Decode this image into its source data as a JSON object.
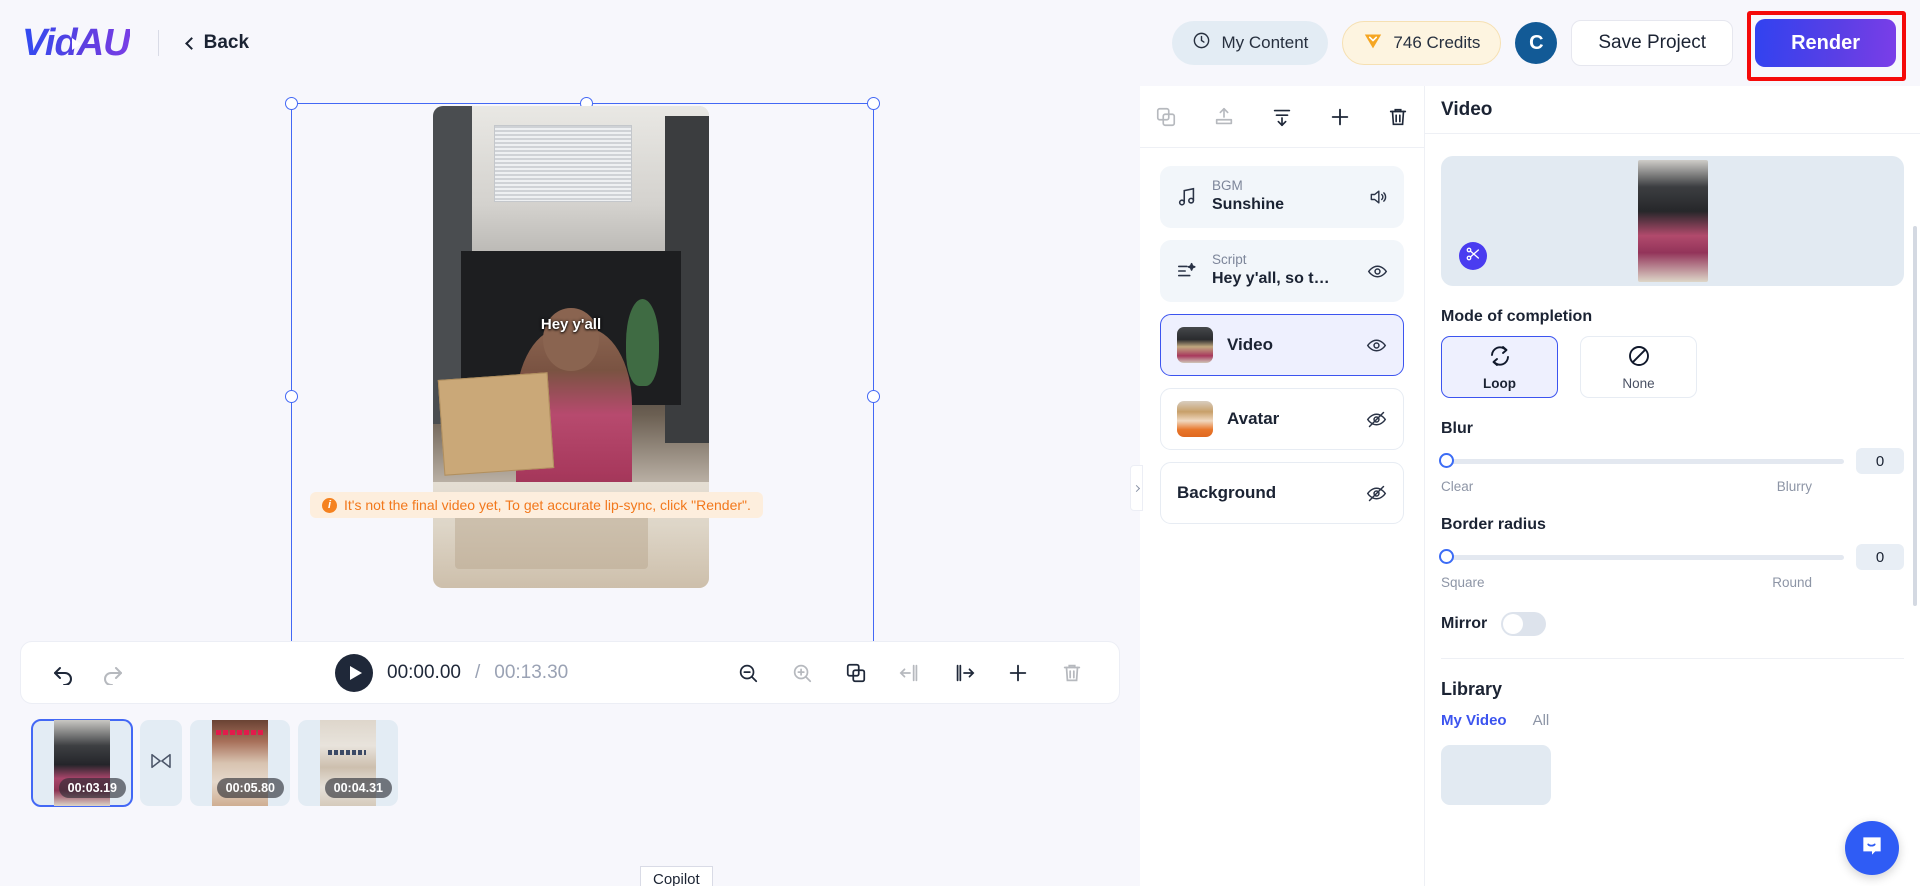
{
  "app": {
    "logo": "VidAU",
    "back_label": "Back"
  },
  "header": {
    "my_content_label": "My Content",
    "credits_label": "746 Credits",
    "avatar_initial": "C",
    "save_label": "Save Project",
    "render_label": "Render",
    "icons": {
      "clock": "clock-icon",
      "gem": "gem-icon"
    },
    "colors": {
      "render_gradient_start": "#3142f0",
      "render_gradient_end": "#7b3ee8",
      "annotation": "#f50a0a",
      "credits_bg": "#fdf4e0",
      "my_content_bg": "#e3ecf4",
      "avatar_bg": "#125a96"
    }
  },
  "canvas": {
    "caption_text": "Hey y'all",
    "warning_text": "It's not the final video yet, To get accurate lip-sync, click \"Render\".",
    "warning_color": "#f2781c"
  },
  "timeline": {
    "current_time": "00:00.00",
    "separator": "/",
    "total_time": "00:13.30",
    "clips": [
      {
        "name": "clip-1",
        "duration": "00:03.19",
        "selected": true
      },
      {
        "name": "clip-2",
        "duration": "00:05.80",
        "selected": false
      },
      {
        "name": "clip-3",
        "duration": "00:04.31",
        "selected": false
      }
    ],
    "icons": {
      "undo": "undo-icon",
      "redo": "redo-icon",
      "play": "play-icon",
      "zoom_out": "zoom-out-icon",
      "zoom_in": "zoom-in-icon",
      "duplicate": "duplicate-icon",
      "split_left": "split-left-icon",
      "split_right": "split-right-icon",
      "add": "plus-icon",
      "delete": "trash-icon",
      "transition": "transition-icon"
    }
  },
  "copilot": {
    "label": "Copilot"
  },
  "layers": {
    "toolbar_icons": [
      "duplicate-icon",
      "bring-forward-icon",
      "send-backward-icon",
      "plus-icon",
      "trash-icon"
    ],
    "items": [
      {
        "sub": "BGM",
        "title": "Sunshine",
        "icon": "music-note-icon",
        "action_icon": "speaker-icon",
        "state": "default"
      },
      {
        "sub": "Script",
        "title": "Hey y'all, so t…",
        "icon": "script-icon",
        "action_icon": "eye-icon",
        "state": "default"
      },
      {
        "sub": "",
        "title": "Video",
        "icon": "video-thumbnail",
        "action_icon": "eye-icon",
        "state": "selected"
      },
      {
        "sub": "",
        "title": "Avatar",
        "icon": "avatar-thumbnail",
        "action_icon": "eye-off-icon",
        "state": "plain"
      },
      {
        "sub": "",
        "title": "Background",
        "icon": "",
        "action_icon": "eye-off-icon",
        "state": "plain"
      }
    ]
  },
  "properties": {
    "title": "Video",
    "crop_icon": "scissors-icon",
    "mode": {
      "label": "Mode of completion",
      "options": [
        {
          "label": "Loop",
          "icon": "loop-icon",
          "selected": true
        },
        {
          "label": "None",
          "icon": "none-icon",
          "selected": false
        }
      ]
    },
    "blur": {
      "label": "Blur",
      "value": "0",
      "min_label": "Clear",
      "max_label": "Blurry"
    },
    "border_radius": {
      "label": "Border radius",
      "value": "0",
      "min_label": "Square",
      "max_label": "Round"
    },
    "mirror": {
      "label": "Mirror",
      "enabled": false
    },
    "library": {
      "title": "Library",
      "tabs": [
        {
          "label": "My Video",
          "active": true
        },
        {
          "label": "All",
          "active": false
        }
      ]
    }
  },
  "support": {
    "icon": "chat-bubble-icon"
  }
}
